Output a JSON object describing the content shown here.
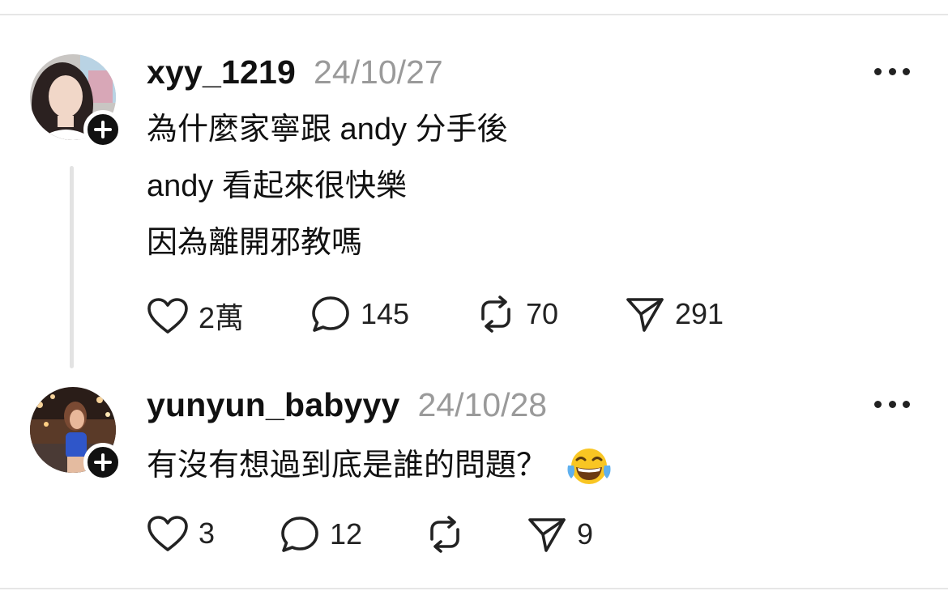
{
  "comments": [
    {
      "username": "xyy_1219",
      "timestamp": "24/10/27",
      "avatar_icon": "profile-photo",
      "body_lines": [
        "為什麼家寧跟 andy 分手後",
        "andy 看起來很快樂",
        "因為離開邪教嗎"
      ],
      "likes": "2萬",
      "replies": "145",
      "reposts": "70",
      "shares": "291"
    },
    {
      "username": "yunyun_babyyy",
      "timestamp": "24/10/28",
      "avatar_icon": "profile-photo",
      "body_lines": [
        "有沒有想過到底是誰的問題？"
      ],
      "body_emoji": "face-with-tears-of-joy",
      "likes": "3",
      "replies": "12",
      "reposts": "",
      "shares": "9"
    }
  ],
  "icons": {
    "like": "heart-icon",
    "reply": "speech-bubble-icon",
    "repost": "repost-icon",
    "share": "send-icon",
    "more": "more-icon",
    "follow": "plus-icon"
  },
  "colors": {
    "text": "#111111",
    "muted": "#9a9a9a",
    "badge": "#111111",
    "divider": "#e6e6e6"
  }
}
